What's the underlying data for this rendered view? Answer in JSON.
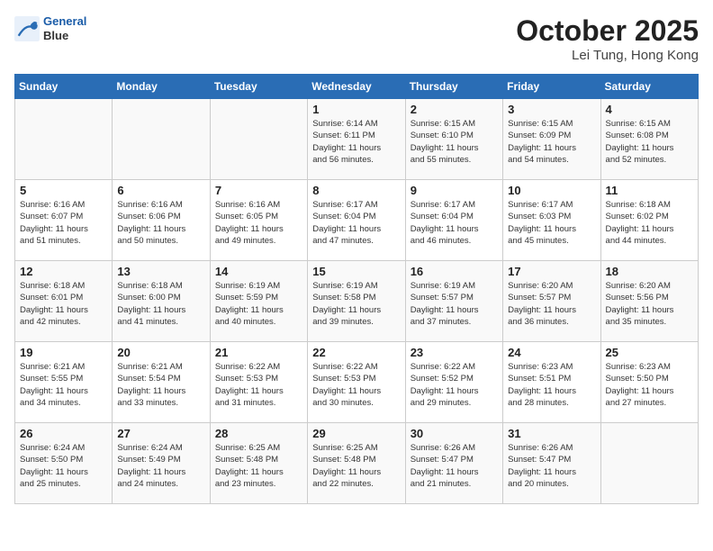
{
  "header": {
    "logo_line1": "General",
    "logo_line2": "Blue",
    "month": "October 2025",
    "location": "Lei Tung, Hong Kong"
  },
  "days_of_week": [
    "Sunday",
    "Monday",
    "Tuesday",
    "Wednesday",
    "Thursday",
    "Friday",
    "Saturday"
  ],
  "weeks": [
    [
      {
        "day": "",
        "info": ""
      },
      {
        "day": "",
        "info": ""
      },
      {
        "day": "",
        "info": ""
      },
      {
        "day": "1",
        "info": "Sunrise: 6:14 AM\nSunset: 6:11 PM\nDaylight: 11 hours\nand 56 minutes."
      },
      {
        "day": "2",
        "info": "Sunrise: 6:15 AM\nSunset: 6:10 PM\nDaylight: 11 hours\nand 55 minutes."
      },
      {
        "day": "3",
        "info": "Sunrise: 6:15 AM\nSunset: 6:09 PM\nDaylight: 11 hours\nand 54 minutes."
      },
      {
        "day": "4",
        "info": "Sunrise: 6:15 AM\nSunset: 6:08 PM\nDaylight: 11 hours\nand 52 minutes."
      }
    ],
    [
      {
        "day": "5",
        "info": "Sunrise: 6:16 AM\nSunset: 6:07 PM\nDaylight: 11 hours\nand 51 minutes."
      },
      {
        "day": "6",
        "info": "Sunrise: 6:16 AM\nSunset: 6:06 PM\nDaylight: 11 hours\nand 50 minutes."
      },
      {
        "day": "7",
        "info": "Sunrise: 6:16 AM\nSunset: 6:05 PM\nDaylight: 11 hours\nand 49 minutes."
      },
      {
        "day": "8",
        "info": "Sunrise: 6:17 AM\nSunset: 6:04 PM\nDaylight: 11 hours\nand 47 minutes."
      },
      {
        "day": "9",
        "info": "Sunrise: 6:17 AM\nSunset: 6:04 PM\nDaylight: 11 hours\nand 46 minutes."
      },
      {
        "day": "10",
        "info": "Sunrise: 6:17 AM\nSunset: 6:03 PM\nDaylight: 11 hours\nand 45 minutes."
      },
      {
        "day": "11",
        "info": "Sunrise: 6:18 AM\nSunset: 6:02 PM\nDaylight: 11 hours\nand 44 minutes."
      }
    ],
    [
      {
        "day": "12",
        "info": "Sunrise: 6:18 AM\nSunset: 6:01 PM\nDaylight: 11 hours\nand 42 minutes."
      },
      {
        "day": "13",
        "info": "Sunrise: 6:18 AM\nSunset: 6:00 PM\nDaylight: 11 hours\nand 41 minutes."
      },
      {
        "day": "14",
        "info": "Sunrise: 6:19 AM\nSunset: 5:59 PM\nDaylight: 11 hours\nand 40 minutes."
      },
      {
        "day": "15",
        "info": "Sunrise: 6:19 AM\nSunset: 5:58 PM\nDaylight: 11 hours\nand 39 minutes."
      },
      {
        "day": "16",
        "info": "Sunrise: 6:19 AM\nSunset: 5:57 PM\nDaylight: 11 hours\nand 37 minutes."
      },
      {
        "day": "17",
        "info": "Sunrise: 6:20 AM\nSunset: 5:57 PM\nDaylight: 11 hours\nand 36 minutes."
      },
      {
        "day": "18",
        "info": "Sunrise: 6:20 AM\nSunset: 5:56 PM\nDaylight: 11 hours\nand 35 minutes."
      }
    ],
    [
      {
        "day": "19",
        "info": "Sunrise: 6:21 AM\nSunset: 5:55 PM\nDaylight: 11 hours\nand 34 minutes."
      },
      {
        "day": "20",
        "info": "Sunrise: 6:21 AM\nSunset: 5:54 PM\nDaylight: 11 hours\nand 33 minutes."
      },
      {
        "day": "21",
        "info": "Sunrise: 6:22 AM\nSunset: 5:53 PM\nDaylight: 11 hours\nand 31 minutes."
      },
      {
        "day": "22",
        "info": "Sunrise: 6:22 AM\nSunset: 5:53 PM\nDaylight: 11 hours\nand 30 minutes."
      },
      {
        "day": "23",
        "info": "Sunrise: 6:22 AM\nSunset: 5:52 PM\nDaylight: 11 hours\nand 29 minutes."
      },
      {
        "day": "24",
        "info": "Sunrise: 6:23 AM\nSunset: 5:51 PM\nDaylight: 11 hours\nand 28 minutes."
      },
      {
        "day": "25",
        "info": "Sunrise: 6:23 AM\nSunset: 5:50 PM\nDaylight: 11 hours\nand 27 minutes."
      }
    ],
    [
      {
        "day": "26",
        "info": "Sunrise: 6:24 AM\nSunset: 5:50 PM\nDaylight: 11 hours\nand 25 minutes."
      },
      {
        "day": "27",
        "info": "Sunrise: 6:24 AM\nSunset: 5:49 PM\nDaylight: 11 hours\nand 24 minutes."
      },
      {
        "day": "28",
        "info": "Sunrise: 6:25 AM\nSunset: 5:48 PM\nDaylight: 11 hours\nand 23 minutes."
      },
      {
        "day": "29",
        "info": "Sunrise: 6:25 AM\nSunset: 5:48 PM\nDaylight: 11 hours\nand 22 minutes."
      },
      {
        "day": "30",
        "info": "Sunrise: 6:26 AM\nSunset: 5:47 PM\nDaylight: 11 hours\nand 21 minutes."
      },
      {
        "day": "31",
        "info": "Sunrise: 6:26 AM\nSunset: 5:47 PM\nDaylight: 11 hours\nand 20 minutes."
      },
      {
        "day": "",
        "info": ""
      }
    ]
  ]
}
